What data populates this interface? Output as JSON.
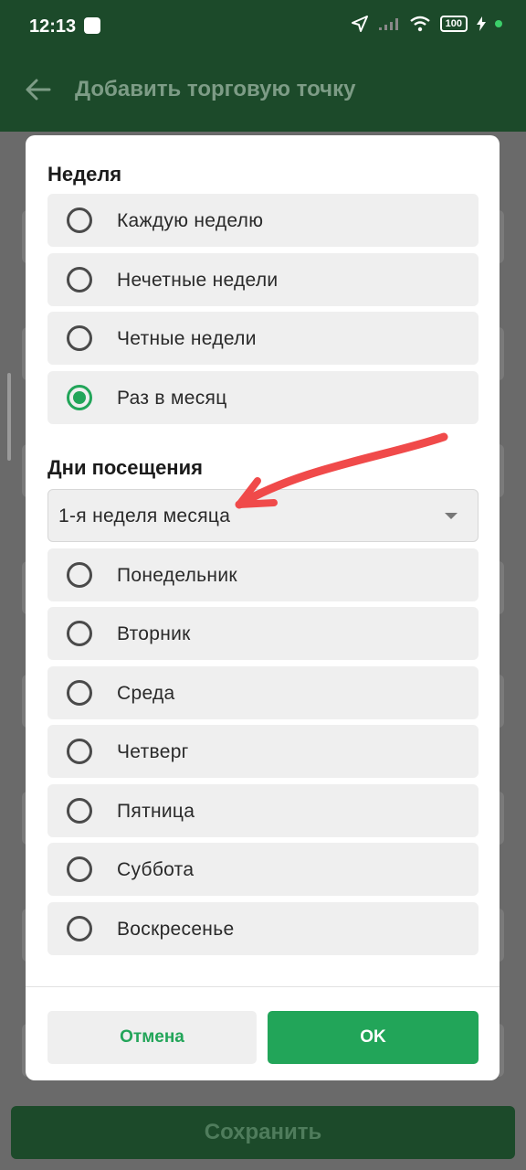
{
  "status_bar": {
    "time": "12:13",
    "battery": "100"
  },
  "app_bar": {
    "title": "Добавить торговую точку"
  },
  "footer": {
    "save_label": "Сохранить"
  },
  "dialog": {
    "week_section": {
      "title": "Неделя",
      "options": [
        {
          "label": "Каждую неделю",
          "selected": false
        },
        {
          "label": "Нечетные недели",
          "selected": false
        },
        {
          "label": "Четные недели",
          "selected": false
        },
        {
          "label": "Раз в месяц",
          "selected": true
        }
      ]
    },
    "days_section": {
      "title": "Дни посещения",
      "dropdown_value": "1-я неделя месяца",
      "days": [
        {
          "label": "Понедельник",
          "selected": false
        },
        {
          "label": "Вторник",
          "selected": false
        },
        {
          "label": "Среда",
          "selected": false
        },
        {
          "label": "Четверг",
          "selected": false
        },
        {
          "label": "Пятница",
          "selected": false
        },
        {
          "label": "Суббота",
          "selected": false
        },
        {
          "label": "Воскресенье",
          "selected": false
        }
      ]
    },
    "cancel_label": "Отмена",
    "ok_label": "OK"
  },
  "colors": {
    "accent": "#22a559",
    "app_bar": "#1c4a2a",
    "annotation_arrow": "#f04a4a"
  }
}
